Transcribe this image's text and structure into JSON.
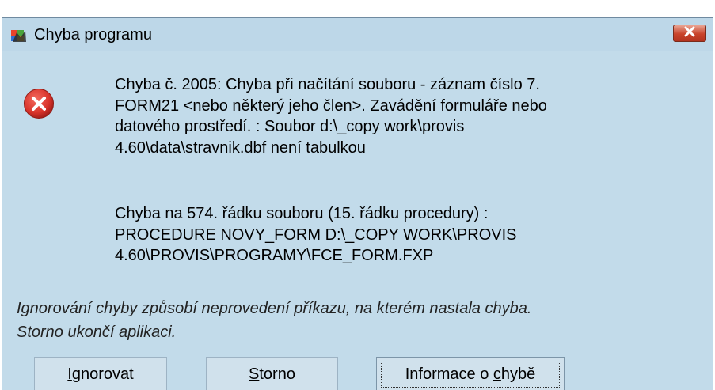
{
  "window": {
    "title": "Chyba programu",
    "app_icon": "foxpro-fox-icon",
    "close_icon": "close-x-icon"
  },
  "error": {
    "icon": "error-circle-x-icon",
    "message_lines": [
      "Chyba č. 2005: Chyba při načítání souboru - záznam číslo 7.",
      "FORM21 <nebo některý jeho člen>. Zavádění formuláře nebo",
      "datového prostředí. : Soubor d:\\_copy work\\provis",
      "4.60\\data\\stravnik.dbf není tabulkou"
    ],
    "location_lines": [
      "Chyba na 574. řádku souboru (15. řádku procedury) :",
      "PROCEDURE NOVY_FORM D:\\_COPY WORK\\PROVIS",
      "4.60\\PROVIS\\PROGRAMY\\FCE_FORM.FXP"
    ]
  },
  "hint": {
    "line1": "Ignorování chyby způsobí neprovedení příkazu, na kterém nastala chyba.",
    "line2": "Storno ukončí aplikaci."
  },
  "buttons": {
    "ignore": {
      "accel": "I",
      "rest": "gnorovat"
    },
    "storno": {
      "accel": "S",
      "rest": "torno"
    },
    "info": {
      "pre": "Informace o ",
      "accel": "c",
      "post": "hybě"
    }
  },
  "colors": {
    "dialog_bg": "#c2dbea",
    "close_button": "#c9442b",
    "error_red": "#d9342b"
  }
}
